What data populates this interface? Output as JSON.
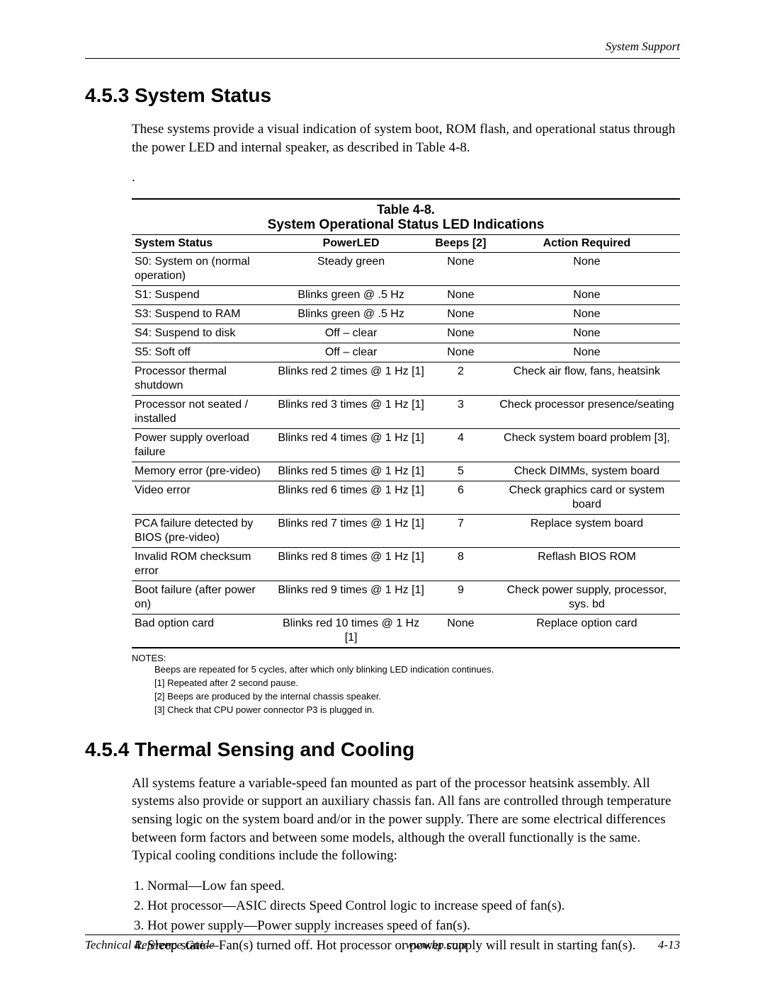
{
  "header": {
    "right": "System Support"
  },
  "section1": {
    "number": "4.5.3",
    "title": "System Status",
    "para": "These systems provide a visual indication of system boot, ROM flash, and operational status through the power LED and internal speaker, as described in Table 4-8."
  },
  "table": {
    "label": "Table 4-8.",
    "title": "System Operational Status LED Indications",
    "headers": {
      "status": "System Status",
      "led": "PowerLED",
      "beeps": "Beeps [2]",
      "action": "Action Required"
    },
    "rows": [
      {
        "status": "S0: System on (normal operation)",
        "led": "Steady green",
        "beeps": "None",
        "action": "None"
      },
      {
        "status": "S1: Suspend",
        "led": "Blinks green @ .5 Hz",
        "beeps": "None",
        "action": "None"
      },
      {
        "status": "S3: Suspend to RAM",
        "led": "Blinks green @ .5 Hz",
        "beeps": "None",
        "action": "None"
      },
      {
        "status": "S4: Suspend to disk",
        "led": "Off – clear",
        "beeps": "None",
        "action": "None"
      },
      {
        "status": "S5: Soft off",
        "led": "Off – clear",
        "beeps": "None",
        "action": "None"
      },
      {
        "status": "Processor thermal shutdown",
        "led": "Blinks red 2 times @ 1 Hz [1]",
        "beeps": "2",
        "action": "Check air flow, fans, heatsink"
      },
      {
        "status": "Processor not seated / installed",
        "led": "Blinks red 3 times @ 1 Hz [1]",
        "beeps": "3",
        "action": "Check processor presence/seating"
      },
      {
        "status": "Power supply overload failure",
        "led": "Blinks red 4 times @ 1 Hz [1]",
        "beeps": "4",
        "action": "Check system board problem [3],"
      },
      {
        "status": "Memory error (pre-video)",
        "led": "Blinks red 5 times @ 1 Hz [1]",
        "beeps": "5",
        "action": "Check DIMMs, system board"
      },
      {
        "status": "Video error",
        "led": "Blinks red 6 times @ 1 Hz [1]",
        "beeps": "6",
        "action": "Check graphics card or system board"
      },
      {
        "status": "PCA failure detected by BIOS (pre-video)",
        "led": "Blinks red 7 times @ 1 Hz [1]",
        "beeps": "7",
        "action": "Replace system board"
      },
      {
        "status": "Invalid ROM checksum error",
        "led": "Blinks red 8 times @ 1 Hz [1]",
        "beeps": "8",
        "action": "Reflash BIOS ROM"
      },
      {
        "status": "Boot failure (after power on)",
        "led": "Blinks red 9 times @ 1 Hz [1]",
        "beeps": "9",
        "action": "Check power supply, processor, sys. bd"
      },
      {
        "status": "Bad option card",
        "led": "Blinks red 10 times @ 1 Hz [1]",
        "beeps": "None",
        "action": "Replace option card"
      }
    ],
    "notes_label": "NOTES:",
    "notes": [
      "Beeps are repeated for 5 cycles, after which only blinking LED indication continues.",
      "[1] Repeated after 2 second pause.",
      "[2] Beeps are produced by the internal chassis speaker.",
      "[3] Check that CPU power connector P3 is plugged in."
    ]
  },
  "section2": {
    "number": "4.5.4",
    "title": "Thermal Sensing and Cooling",
    "para": "All systems feature a variable-speed fan mounted as part of the processor heatsink assembly. All systems also provide or support an auxiliary chassis fan. All fans are controlled through temperature sensing logic on the system board and/or in the power supply. There are some electrical differences between form factors and between some models, although the overall functionally is the same. Typical cooling conditions include the following:",
    "list": [
      "Normal—Low fan speed.",
      "Hot processor—ASIC directs Speed Control logic to increase speed of fan(s).",
      "Hot power supply—Power supply increases speed of fan(s).",
      "Sleep state—Fan(s) turned off. Hot processor or power supply will result in starting fan(s)."
    ]
  },
  "footer": {
    "left": "Technical Reference Guide",
    "center": "www.hp.com",
    "right": "4-13"
  }
}
